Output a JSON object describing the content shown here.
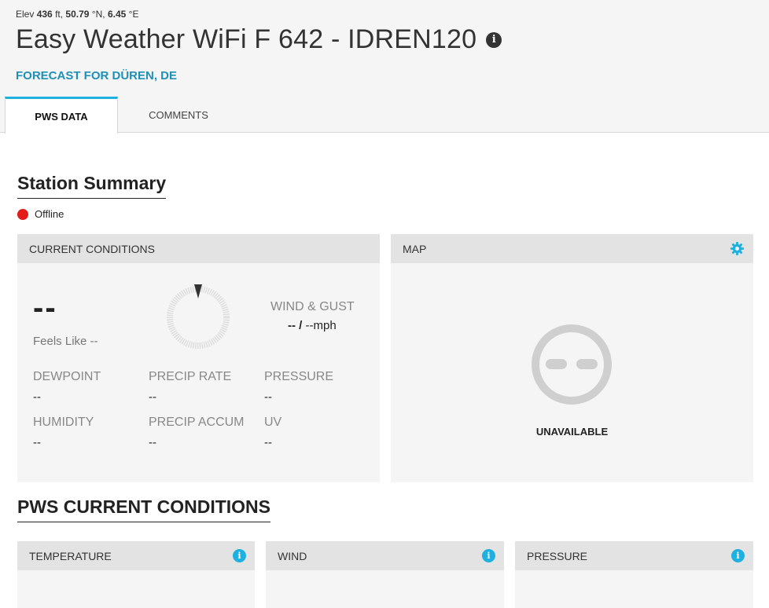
{
  "station": {
    "elev_label": "Elev",
    "elev_value": "436",
    "elev_unit": "ft,",
    "lat_value": "50.79",
    "lat_unit": "°N,",
    "lon_value": "6.45",
    "lon_unit": "°E",
    "title": "Easy Weather WiFi F 642 - IDREN120",
    "forecast_link": "FORECAST FOR DÜREN, DE"
  },
  "tabs": [
    {
      "label": "PWS DATA",
      "active": true
    },
    {
      "label": "COMMENTS",
      "active": false
    }
  ],
  "summary": {
    "title": "Station Summary",
    "status": "Offline",
    "status_color": "#e41b1b"
  },
  "current_conditions": {
    "header": "CURRENT CONDITIONS",
    "temperature": "--",
    "feels_like": "Feels Like --",
    "wind_label": "WIND & GUST",
    "wind_speed": "--",
    "wind_separator": " / ",
    "wind_gust": "--mph",
    "metrics": [
      {
        "label": "DEWPOINT",
        "value": "--"
      },
      {
        "label": "PRECIP RATE",
        "value": "--"
      },
      {
        "label": "PRESSURE",
        "value": "--"
      },
      {
        "label": "HUMIDITY",
        "value": "--"
      },
      {
        "label": "PRECIP ACCUM",
        "value": "--"
      },
      {
        "label": "UV",
        "value": "--"
      }
    ]
  },
  "map": {
    "header": "MAP",
    "status": "UNAVAILABLE"
  },
  "pws_current": {
    "title": "PWS CURRENT CONDITIONS",
    "panels": [
      {
        "label": "TEMPERATURE"
      },
      {
        "label": "WIND"
      },
      {
        "label": "PRESSURE"
      }
    ]
  },
  "icons": {
    "info": "info-icon",
    "gear": "gear-icon",
    "unavailable": "unavailable-face-icon",
    "compass": "wind-compass-icon"
  },
  "colors": {
    "accent": "#1eb1e0",
    "link": "#1e8fb5",
    "offline": "#e41b1b"
  }
}
